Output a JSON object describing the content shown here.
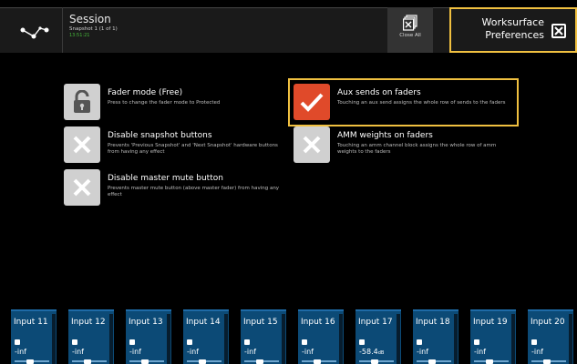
{
  "header": {
    "session_title": "Session",
    "snapshot_info": "Snapshot 1 (1 of 1)",
    "status_text": "13:51:21",
    "close_all_label": "Close All",
    "prefs_title_line1": "Worksurface",
    "prefs_title_line2": "Preferences"
  },
  "options": [
    {
      "title": "Fader mode (Free)",
      "desc": "Press to change the fader mode to Protected",
      "icon": "unlock-icon",
      "state": "info"
    },
    {
      "title": "Disable snapshot buttons",
      "desc": "Prevents 'Previous Snapshot' and 'Next Snapshot' hardware buttons from having any effect",
      "icon": "x-icon",
      "state": "off"
    },
    {
      "title": "Disable master mute button",
      "desc": "Prevents master mute button (above master fader) from having any effect",
      "icon": "x-icon",
      "state": "off"
    },
    {
      "title": "Aux sends on faders",
      "desc": "Touching an aux send assigns the whole row of sends to the faders",
      "icon": "check-icon",
      "state": "on"
    },
    {
      "title": "AMM weights on faders",
      "desc": "Touching an amm channel block assigns the whole row of amm weights to the faders",
      "icon": "x-icon",
      "state": "off"
    }
  ],
  "strips": [
    {
      "label": "Input 11",
      "value": "-inf",
      "unit": ""
    },
    {
      "label": "Input 12",
      "value": "-inf",
      "unit": ""
    },
    {
      "label": "Input 13",
      "value": "-inf",
      "unit": ""
    },
    {
      "label": "Input 14",
      "value": "-inf",
      "unit": ""
    },
    {
      "label": "Input 15",
      "value": "-inf",
      "unit": ""
    },
    {
      "label": "Input 16",
      "value": "-inf",
      "unit": ""
    },
    {
      "label": "Input 17",
      "value": "-58.4",
      "unit": "dB"
    },
    {
      "label": "Input 18",
      "value": "-inf",
      "unit": ""
    },
    {
      "label": "Input 19",
      "value": "-inf",
      "unit": ""
    },
    {
      "label": "Input 20",
      "value": "-inf",
      "unit": ""
    }
  ],
  "colors": {
    "accent_highlight": "#f0c040",
    "active_red": "#e04a2a",
    "strip_blue": "#0c4a76",
    "status_green": "#46b83a"
  }
}
